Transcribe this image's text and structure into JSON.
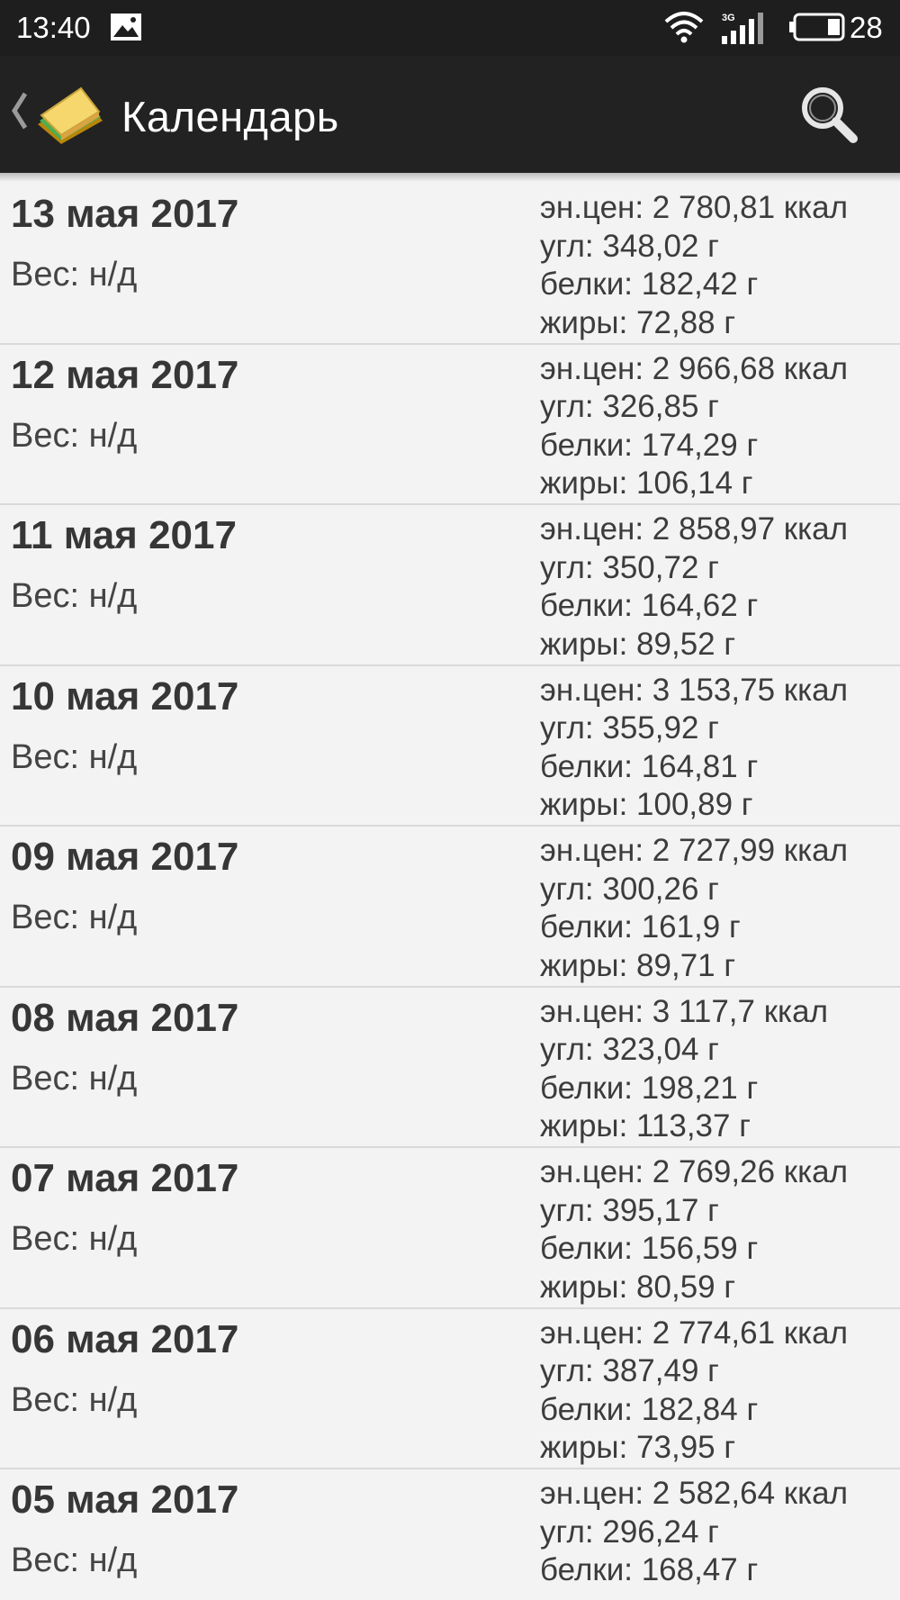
{
  "status_bar": {
    "time": "13:40",
    "network": "3G",
    "battery_level": "28"
  },
  "app_bar": {
    "title": "Календарь"
  },
  "days": [
    {
      "date": "13 мая 2017",
      "weight": "Вес: н/д",
      "energy": "эн.цен: 2 780,81 ккал",
      "carbs": "угл: 348,02 г",
      "protein": "белки: 182,42 г",
      "fat": "жиры: 72,88 г"
    },
    {
      "date": "12 мая 2017",
      "weight": "Вес: н/д",
      "energy": "эн.цен: 2 966,68 ккал",
      "carbs": "угл: 326,85 г",
      "protein": "белки: 174,29 г",
      "fat": "жиры: 106,14 г"
    },
    {
      "date": "11 мая 2017",
      "weight": "Вес: н/д",
      "energy": "эн.цен: 2 858,97 ккал",
      "carbs": "угл: 350,72 г",
      "protein": "белки: 164,62 г",
      "fat": "жиры: 89,52 г"
    },
    {
      "date": "10 мая 2017",
      "weight": "Вес: н/д",
      "energy": "эн.цен: 3 153,75 ккал",
      "carbs": "угл: 355,92 г",
      "protein": "белки: 164,81 г",
      "fat": "жиры: 100,89 г"
    },
    {
      "date": "09 мая 2017",
      "weight": "Вес: н/д",
      "energy": "эн.цен: 2 727,99 ккал",
      "carbs": "угл: 300,26 г",
      "protein": "белки: 161,9 г",
      "fat": "жиры: 89,71 г"
    },
    {
      "date": "08 мая 2017",
      "weight": "Вес: н/д",
      "energy": "эн.цен: 3 117,7 ккал",
      "carbs": "угл: 323,04 г",
      "protein": "белки: 198,21 г",
      "fat": "жиры: 113,37 г"
    },
    {
      "date": "07 мая 2017",
      "weight": "Вес: н/д",
      "energy": "эн.цен: 2 769,26 ккал",
      "carbs": "угл: 395,17 г",
      "protein": "белки: 156,59 г",
      "fat": "жиры: 80,59 г"
    },
    {
      "date": "06 мая 2017",
      "weight": "Вес: н/д",
      "energy": "эн.цен: 2 774,61 ккал",
      "carbs": "угл: 387,49 г",
      "protein": "белки: 182,84 г",
      "fat": "жиры: 73,95 г"
    },
    {
      "date": "05 мая 2017",
      "weight": "Вес: н/д",
      "energy": "эн.цен: 2 582,64 ккал",
      "carbs": "угл: 296,24 г",
      "protein": "белки: 168,47 г",
      "fat": ""
    }
  ]
}
